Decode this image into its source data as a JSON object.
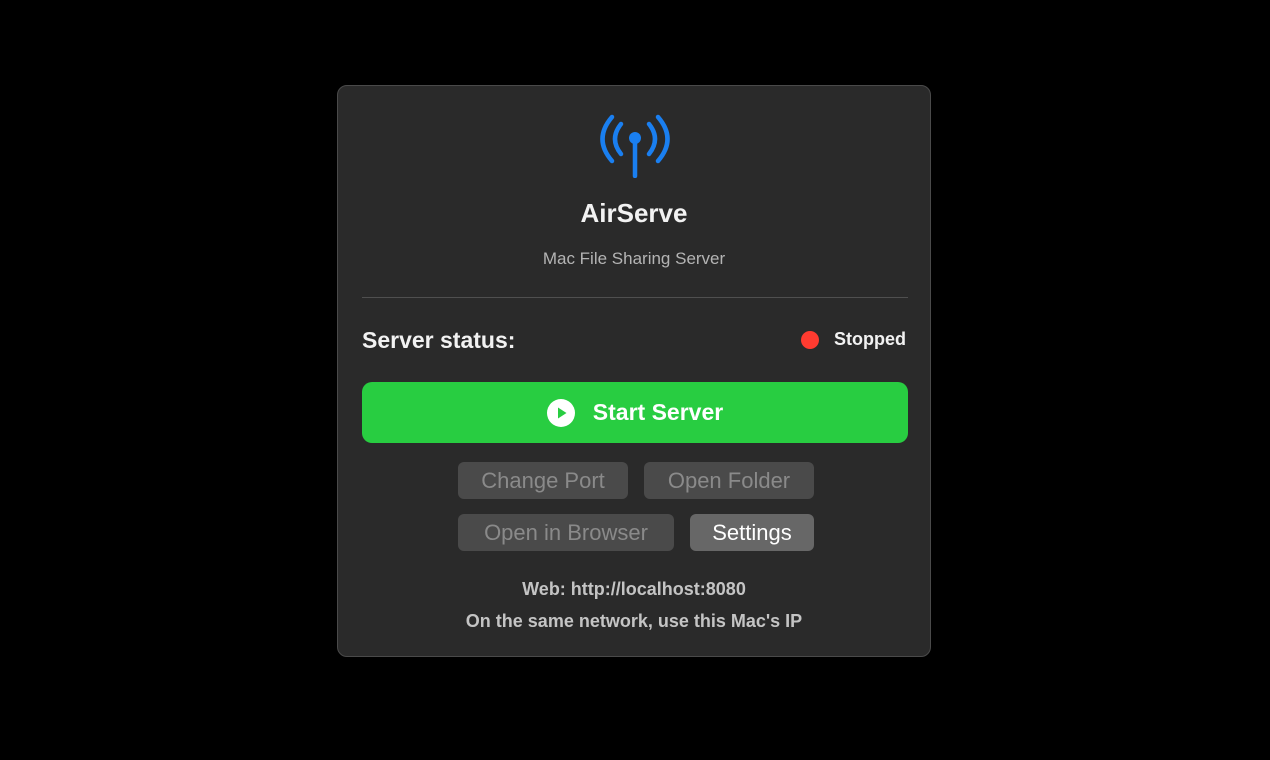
{
  "app": {
    "title": "AirServe",
    "subtitle": "Mac File Sharing Server",
    "icon": "antenna-broadcast-icon",
    "icon_color": "#1a7ff0"
  },
  "status": {
    "label": "Server status:",
    "value": "Stopped",
    "dot_color": "#ff3b30"
  },
  "start_button": {
    "label": "Start Server",
    "icon": "play-circle-icon",
    "color": "#28cd41"
  },
  "buttons": {
    "change_port": "Change Port",
    "open_folder": "Open Folder",
    "open_browser": "Open in Browser",
    "settings": "Settings"
  },
  "info": {
    "web": "Web: http://localhost:8080",
    "network": "On the same network, use this Mac's IP"
  }
}
